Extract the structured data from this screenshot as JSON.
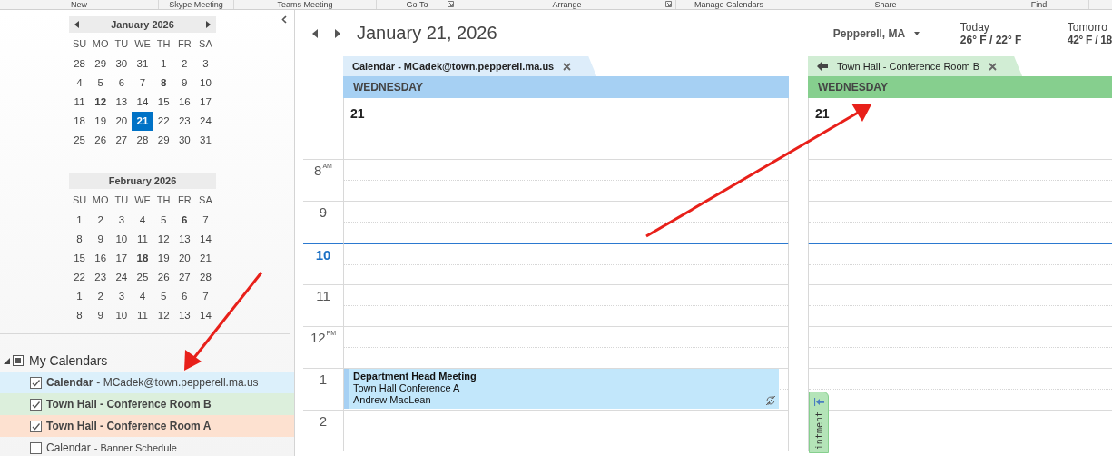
{
  "ribbon": [
    {
      "label": "New",
      "launcher": false
    },
    {
      "label": "Skype Meeting",
      "launcher": false
    },
    {
      "label": "Teams Meeting",
      "launcher": false
    },
    {
      "label": "Go To",
      "launcher": true
    },
    {
      "label": "Arrange",
      "launcher": true
    },
    {
      "label": "Manage Calendars",
      "launcher": false
    },
    {
      "label": "Share",
      "launcher": false
    },
    {
      "label": "Find",
      "launcher": false
    }
  ],
  "months": [
    {
      "title": "January 2026",
      "nav": true,
      "weekdays": [
        "SU",
        "MO",
        "TU",
        "WE",
        "TH",
        "FR",
        "SA"
      ],
      "weeks": [
        [
          {
            "day": "28",
            "bold": false,
            "selected": false
          },
          {
            "day": "29",
            "bold": false,
            "selected": false
          },
          {
            "day": "30",
            "bold": false,
            "selected": false
          },
          {
            "day": "31",
            "bold": false,
            "selected": false
          },
          {
            "day": "1",
            "bold": false,
            "selected": false
          },
          {
            "day": "2",
            "bold": false,
            "selected": false
          },
          {
            "day": "3",
            "bold": false,
            "selected": false
          }
        ],
        [
          {
            "day": "4",
            "bold": false,
            "selected": false
          },
          {
            "day": "5",
            "bold": false,
            "selected": false
          },
          {
            "day": "6",
            "bold": false,
            "selected": false
          },
          {
            "day": "7",
            "bold": false,
            "selected": false
          },
          {
            "day": "8",
            "bold": true,
            "selected": false
          },
          {
            "day": "9",
            "bold": false,
            "selected": false
          },
          {
            "day": "10",
            "bold": false,
            "selected": false
          }
        ],
        [
          {
            "day": "11",
            "bold": false,
            "selected": false
          },
          {
            "day": "12",
            "bold": true,
            "selected": false
          },
          {
            "day": "13",
            "bold": false,
            "selected": false
          },
          {
            "day": "14",
            "bold": false,
            "selected": false
          },
          {
            "day": "15",
            "bold": false,
            "selected": false
          },
          {
            "day": "16",
            "bold": false,
            "selected": false
          },
          {
            "day": "17",
            "bold": false,
            "selected": false
          }
        ],
        [
          {
            "day": "18",
            "bold": false,
            "selected": false
          },
          {
            "day": "19",
            "bold": false,
            "selected": false
          },
          {
            "day": "20",
            "bold": false,
            "selected": false
          },
          {
            "day": "21",
            "bold": false,
            "selected": true
          },
          {
            "day": "22",
            "bold": false,
            "selected": false
          },
          {
            "day": "23",
            "bold": false,
            "selected": false
          },
          {
            "day": "24",
            "bold": false,
            "selected": false
          }
        ],
        [
          {
            "day": "25",
            "bold": false,
            "selected": false
          },
          {
            "day": "26",
            "bold": false,
            "selected": false
          },
          {
            "day": "27",
            "bold": false,
            "selected": false
          },
          {
            "day": "28",
            "bold": false,
            "selected": false
          },
          {
            "day": "29",
            "bold": false,
            "selected": false
          },
          {
            "day": "30",
            "bold": false,
            "selected": false
          },
          {
            "day": "31",
            "bold": false,
            "selected": false
          }
        ]
      ]
    },
    {
      "title": "February 2026",
      "nav": false,
      "weekdays": [
        "SU",
        "MO",
        "TU",
        "WE",
        "TH",
        "FR",
        "SA"
      ],
      "weeks": [
        [
          {
            "day": "1",
            "bold": false,
            "selected": false
          },
          {
            "day": "2",
            "bold": false,
            "selected": false
          },
          {
            "day": "3",
            "bold": false,
            "selected": false
          },
          {
            "day": "4",
            "bold": false,
            "selected": false
          },
          {
            "day": "5",
            "bold": false,
            "selected": false
          },
          {
            "day": "6",
            "bold": true,
            "selected": false
          },
          {
            "day": "7",
            "bold": false,
            "selected": false
          }
        ],
        [
          {
            "day": "8",
            "bold": false,
            "selected": false
          },
          {
            "day": "9",
            "bold": false,
            "selected": false
          },
          {
            "day": "10",
            "bold": false,
            "selected": false
          },
          {
            "day": "11",
            "bold": false,
            "selected": false
          },
          {
            "day": "12",
            "bold": false,
            "selected": false
          },
          {
            "day": "13",
            "bold": false,
            "selected": false
          },
          {
            "day": "14",
            "bold": false,
            "selected": false
          }
        ],
        [
          {
            "day": "15",
            "bold": false,
            "selected": false
          },
          {
            "day": "16",
            "bold": false,
            "selected": false
          },
          {
            "day": "17",
            "bold": false,
            "selected": false
          },
          {
            "day": "18",
            "bold": true,
            "selected": false
          },
          {
            "day": "19",
            "bold": false,
            "selected": false
          },
          {
            "day": "20",
            "bold": false,
            "selected": false
          },
          {
            "day": "21",
            "bold": false,
            "selected": false
          }
        ],
        [
          {
            "day": "22",
            "bold": false,
            "selected": false
          },
          {
            "day": "23",
            "bold": false,
            "selected": false
          },
          {
            "day": "24",
            "bold": false,
            "selected": false
          },
          {
            "day": "25",
            "bold": false,
            "selected": false
          },
          {
            "day": "26",
            "bold": false,
            "selected": false
          },
          {
            "day": "27",
            "bold": false,
            "selected": false
          },
          {
            "day": "28",
            "bold": false,
            "selected": false
          }
        ],
        [
          {
            "day": "1",
            "bold": false,
            "selected": false
          },
          {
            "day": "2",
            "bold": false,
            "selected": false
          },
          {
            "day": "3",
            "bold": false,
            "selected": false
          },
          {
            "day": "4",
            "bold": false,
            "selected": false
          },
          {
            "day": "5",
            "bold": false,
            "selected": false
          },
          {
            "day": "6",
            "bold": false,
            "selected": false
          },
          {
            "day": "7",
            "bold": false,
            "selected": false
          }
        ],
        [
          {
            "day": "8",
            "bold": false,
            "selected": false
          },
          {
            "day": "9",
            "bold": false,
            "selected": false
          },
          {
            "day": "10",
            "bold": false,
            "selected": false
          },
          {
            "day": "11",
            "bold": false,
            "selected": false
          },
          {
            "day": "12",
            "bold": false,
            "selected": false
          },
          {
            "day": "13",
            "bold": false,
            "selected": false
          },
          {
            "day": "14",
            "bold": false,
            "selected": false
          }
        ]
      ]
    }
  ],
  "calendar_group": {
    "title": "My Calendars",
    "expanded": true,
    "items": [
      {
        "name": "Calendar",
        "detail": "- MCadek@town.pepperell.ma.us",
        "checked": true,
        "color": "#dcf0fb"
      },
      {
        "name": "Town Hall - Conference Room B",
        "checked": true,
        "color": "#dcefdc"
      },
      {
        "name": "Town Hall - Conference Room A",
        "checked": true,
        "color": "#fde1d0"
      },
      {
        "name": "Calendar",
        "detail": "- Banner Schedule",
        "checked": false
      }
    ]
  },
  "view": {
    "title": "January 21, 2026",
    "weather": {
      "location": "Pepperell, MA",
      "days": [
        {
          "label": "Today",
          "temps": "26° F / 22° F"
        },
        {
          "label": "Tomorro",
          "temps": "42° F / 18"
        }
      ]
    },
    "hours": [
      {
        "label": "8",
        "suffix": "AM",
        "current": false
      },
      {
        "label": "9",
        "current": false
      },
      {
        "label": "10",
        "current": true
      },
      {
        "label": "11",
        "current": false
      },
      {
        "label": "12",
        "suffix": "PM",
        "current": false
      },
      {
        "label": "1",
        "current": false
      },
      {
        "label": "2",
        "current": false
      }
    ],
    "panels": [
      {
        "tab": "Calendar - MCadek@town.pepperell.ma.us",
        "overlay": false,
        "color": "#a6d0f3",
        "weekday": "WEDNESDAY",
        "date": "21",
        "slots": [
          {
            "busy": false
          },
          {
            "busy": false
          },
          {
            "busy": false
          },
          {
            "busy": false
          },
          {
            "busy": false
          },
          {
            "busy": true,
            "title": "Department Head Meeting",
            "location": "Town Hall Conference A",
            "organizer": "Andrew MacLean"
          },
          {
            "busy": false
          }
        ]
      },
      {
        "tab": "Town Hall - Conference Room B",
        "overlay": true,
        "color": "#86cf8e",
        "weekday": "WEDNESDAY",
        "date": "21",
        "slots": [
          {
            "busy": false
          },
          {
            "busy": false
          },
          {
            "busy": false
          },
          {
            "busy": false
          },
          {
            "busy": false
          },
          {
            "busy": false
          },
          {
            "busy": false
          }
        ],
        "side_tab": "intment"
      }
    ]
  }
}
